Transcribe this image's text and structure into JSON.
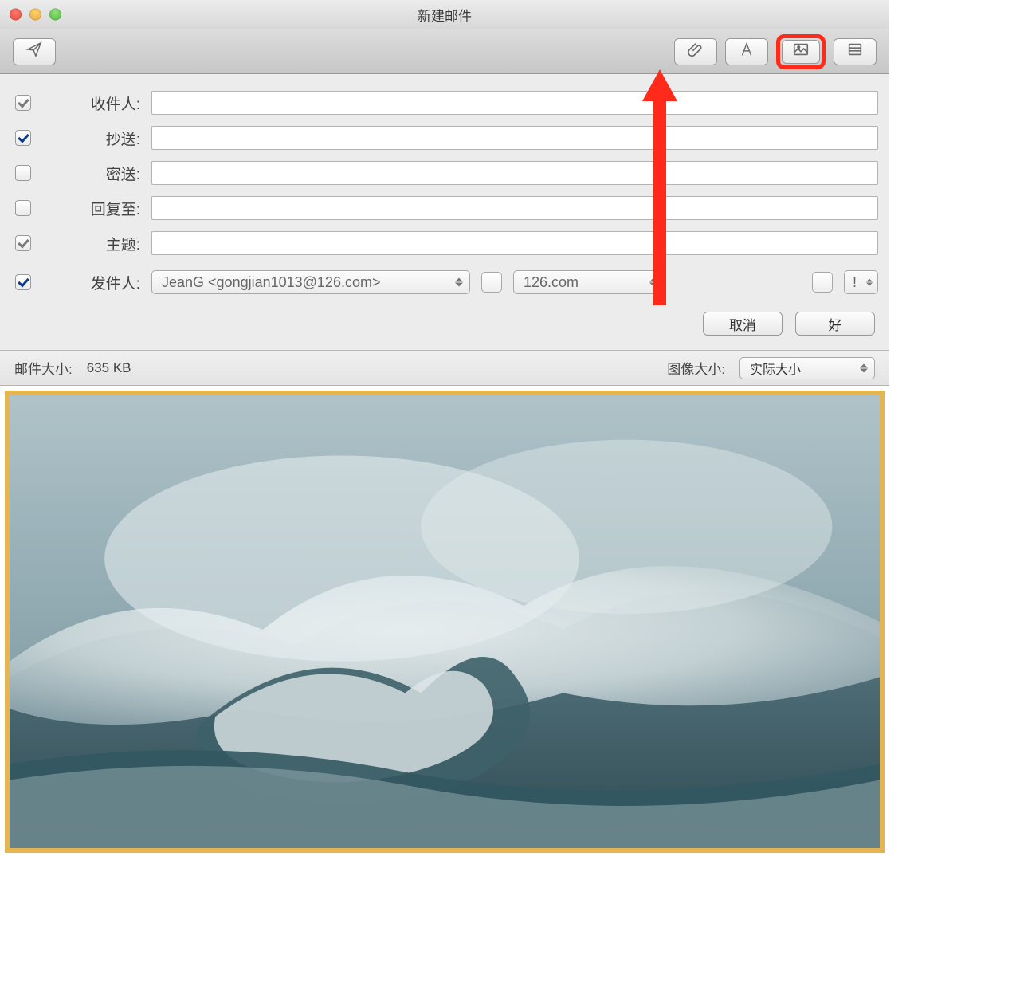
{
  "window": {
    "title": "新建邮件"
  },
  "toolbar": {
    "send": "send",
    "attach": "attach",
    "font": "font",
    "photo": "photo",
    "stationery": "stationery"
  },
  "fields": {
    "to": {
      "label": "收件人:",
      "value": ""
    },
    "cc": {
      "label": "抄送:",
      "value": ""
    },
    "bcc": {
      "label": "密送:",
      "value": ""
    },
    "reply_to": {
      "label": "回复至:",
      "value": ""
    },
    "subject": {
      "label": "主题:",
      "value": ""
    },
    "from": {
      "label": "发件人:"
    },
    "from_select": "JeanG <gongjian1013@126.com>",
    "server_select": "126.com",
    "priority_symbol": "!"
  },
  "buttons": {
    "cancel": "取消",
    "ok": "好"
  },
  "sizebar": {
    "mail_size_label": "邮件大小:",
    "mail_size_value": "635 KB",
    "image_size_label": "图像大小:",
    "image_size_value": "实际大小"
  }
}
